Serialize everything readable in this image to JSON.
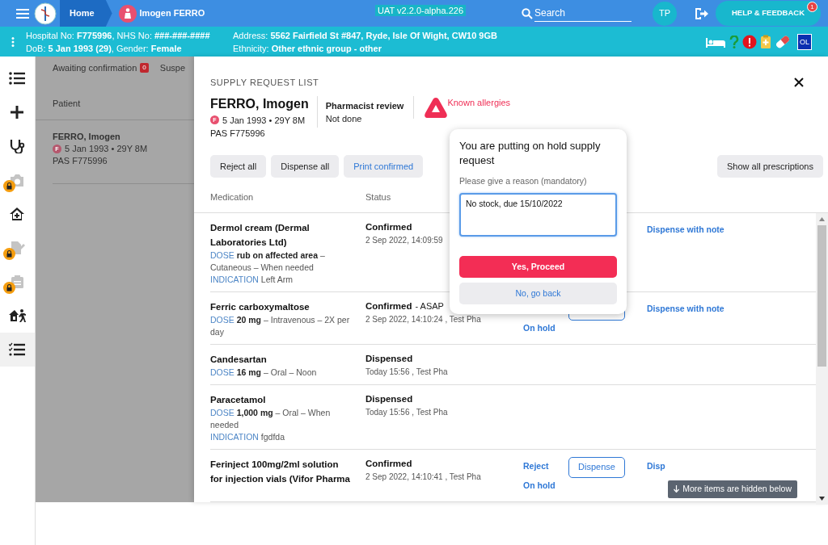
{
  "top_bar": {
    "breadcrumbs": [
      {
        "kind": "home",
        "label": "Home"
      },
      {
        "kind": "patient",
        "label": "Imogen FERRO"
      }
    ],
    "environment": "UAT v2.2.0-alpha.226",
    "search": {
      "placeholder": "Search"
    },
    "user_initials": "TP",
    "help_button": {
      "label": "HELP & FEEDBACK",
      "badge": "1"
    }
  },
  "patient_banner": {
    "lines": [
      "Hospital No: **F775996**, NHS No: **###-###-####**",
      "DoB: **5 Jan 1993 (29)**, Gender: **Female**",
      "Address: **5562 Fairfield St #847, Ryde, Isle Of Wight, CW10 9GB**",
      "Ethnicity: **Other ethnic group - other**"
    ],
    "badge": "OL"
  },
  "sidebar": {
    "items": [
      {
        "selected": false,
        "locked": false
      },
      {
        "selected": false,
        "locked": false
      },
      {
        "selected": false,
        "locked": false
      },
      {
        "selected": false,
        "locked": true
      },
      {
        "selected": false,
        "locked": false
      },
      {
        "selected": false,
        "locked": true
      },
      {
        "selected": false,
        "locked": true
      },
      {
        "selected": false,
        "locked": false
      },
      {
        "selected": true,
        "locked": false
      }
    ]
  },
  "background_list": {
    "tabs": [
      {
        "label": "Awaiting confirmation",
        "count": "0"
      },
      {
        "label": "Suspe"
      }
    ],
    "columns": [
      "Patient"
    ],
    "row": {
      "name": "FERRO, Imogen",
      "sex": "F",
      "dob": "5 Jan 1993 • 29Y 8M",
      "pas": "PAS F775996"
    }
  },
  "panel": {
    "title": "SUPPLY REQUEST LIST",
    "patient": {
      "name": "FERRO, Imogen",
      "sex": "F",
      "dob": "5 Jan 1993 • 29Y 8M",
      "pas": "PAS F775996"
    },
    "review": {
      "label": "Pharmacist review",
      "value": "Not done"
    },
    "allergies": "Known allergies",
    "buttons": [
      {
        "kind": "plain",
        "label": "Reject all"
      },
      {
        "kind": "plain",
        "label": "Dispense all"
      },
      {
        "kind": "link",
        "label": "Print confirmed"
      }
    ],
    "show_all": "Show all prescriptions",
    "columns": [
      "Medication",
      "Status"
    ],
    "rows": [
      {
        "name": "Dermol cream (Dermal Laboratories Ltd)",
        "details": [
          {
            "label": "DOSE",
            "text": "**rub on affected area** – Cutaneous – When needed"
          },
          {
            "label": "INDICATION",
            "text": "Left Arm"
          }
        ],
        "status": "Confirmed",
        "meta": "2 Sep 2022, 14:09:59",
        "actions": [
          {
            "kind": "note",
            "label": "Dispense with note"
          }
        ]
      },
      {
        "name": "Ferric carboxymaltose",
        "details": [
          {
            "label": "DOSE",
            "text": "**20 mg** – Intravenous – 2X per day"
          }
        ],
        "status": "Confirmed",
        "priority": "- ASAP",
        "meta": "2 Sep 2022, 14:10:24 , Test Pha",
        "actions": [
          {
            "kind": "hold",
            "label": "On hold"
          },
          {
            "kind": "covered"
          },
          {
            "kind": "note",
            "label": "Dispense with note"
          }
        ]
      },
      {
        "name": "Candesartan",
        "details": [
          {
            "label": "DOSE",
            "text": "**16 mg** – Oral – Noon"
          }
        ],
        "status": "Dispensed",
        "meta": "Today 15:56 , Test Pha",
        "actions": []
      },
      {
        "name": "Paracetamol",
        "details": [
          {
            "label": "DOSE",
            "text": "**1,000 mg** – Oral – When needed"
          },
          {
            "label": "INDICATION",
            "text": "fgdfda"
          }
        ],
        "status": "Dispensed",
        "meta": "Today 15:56 , Test Pha",
        "actions": []
      },
      {
        "name": "Ferinject 100mg/2ml solution for injection vials (Vifor Pharma",
        "details": [],
        "status": "Confirmed",
        "meta": "2 Sep 2022, 14:10:41 , Test Pha",
        "actions": [
          {
            "kind": "reject",
            "label": "Reject"
          },
          {
            "kind": "hold",
            "label": "On hold"
          },
          {
            "kind": "dispense",
            "label": "Dispense"
          },
          {
            "kind": "note",
            "label": "Disp"
          }
        ]
      }
    ],
    "hidden_hint": "More items are hidden below"
  },
  "popover": {
    "title": "You are putting on hold supply request",
    "prompt": "Please give a reason (mandatory)",
    "value": "No stock, due 15/10/2022",
    "confirm": "Yes, Proceed",
    "cancel": "No, go back"
  }
}
